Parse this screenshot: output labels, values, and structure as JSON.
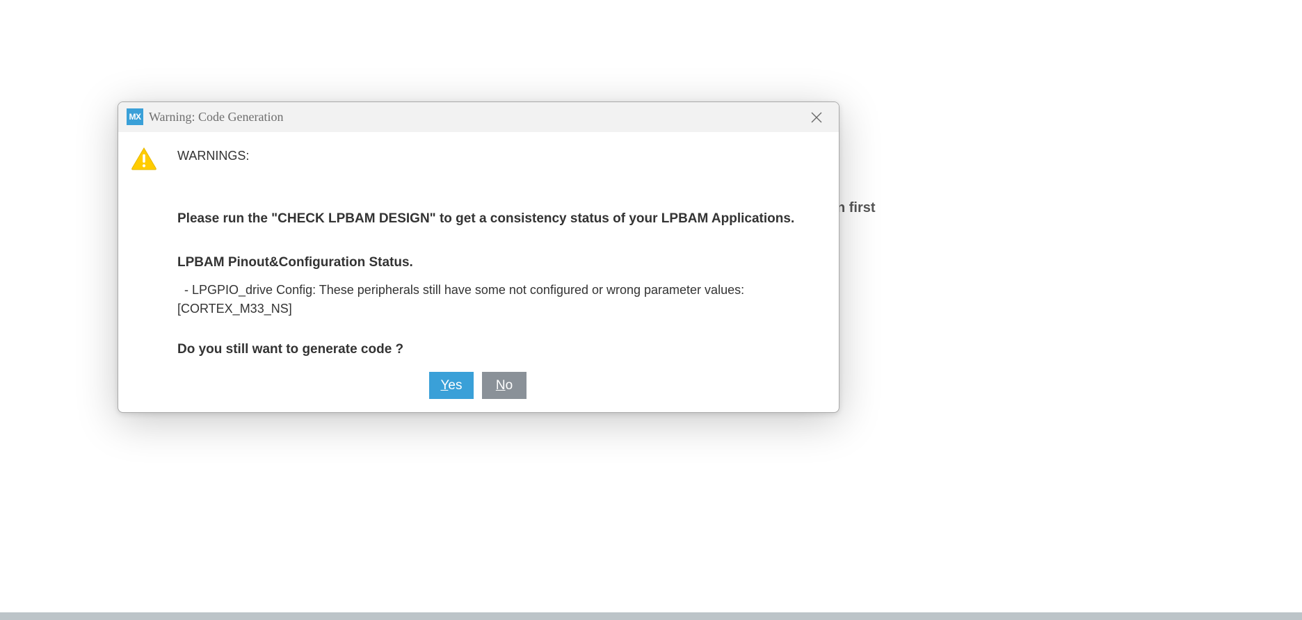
{
  "background": {
    "partial_text": "n first"
  },
  "dialog": {
    "app_icon_text": "MX",
    "title": "Warning: Code Generation",
    "warnings_label": "WARNINGS:",
    "message_line1": "Please run the \"CHECK LPBAM DESIGN\" to get a consistency status of your LPBAM Applications.",
    "status_heading": "LPBAM Pinout&Configuration Status.",
    "status_detail": "  - LPGPIO_drive Config: These peripherals still have some not configured or wrong parameter values: [CORTEX_M33_NS]",
    "question": "Do you still want to generate code ?",
    "yes_mnemonic": "Y",
    "yes_rest": "es",
    "no_mnemonic": "N",
    "no_rest": "o",
    "colors": {
      "accent": "#3aa0d8",
      "no_button": "#8a9198",
      "warning_icon": "#ffcc00"
    },
    "icons": {
      "app": "mx-app-icon",
      "close": "close-icon",
      "warning": "warning-icon"
    }
  }
}
